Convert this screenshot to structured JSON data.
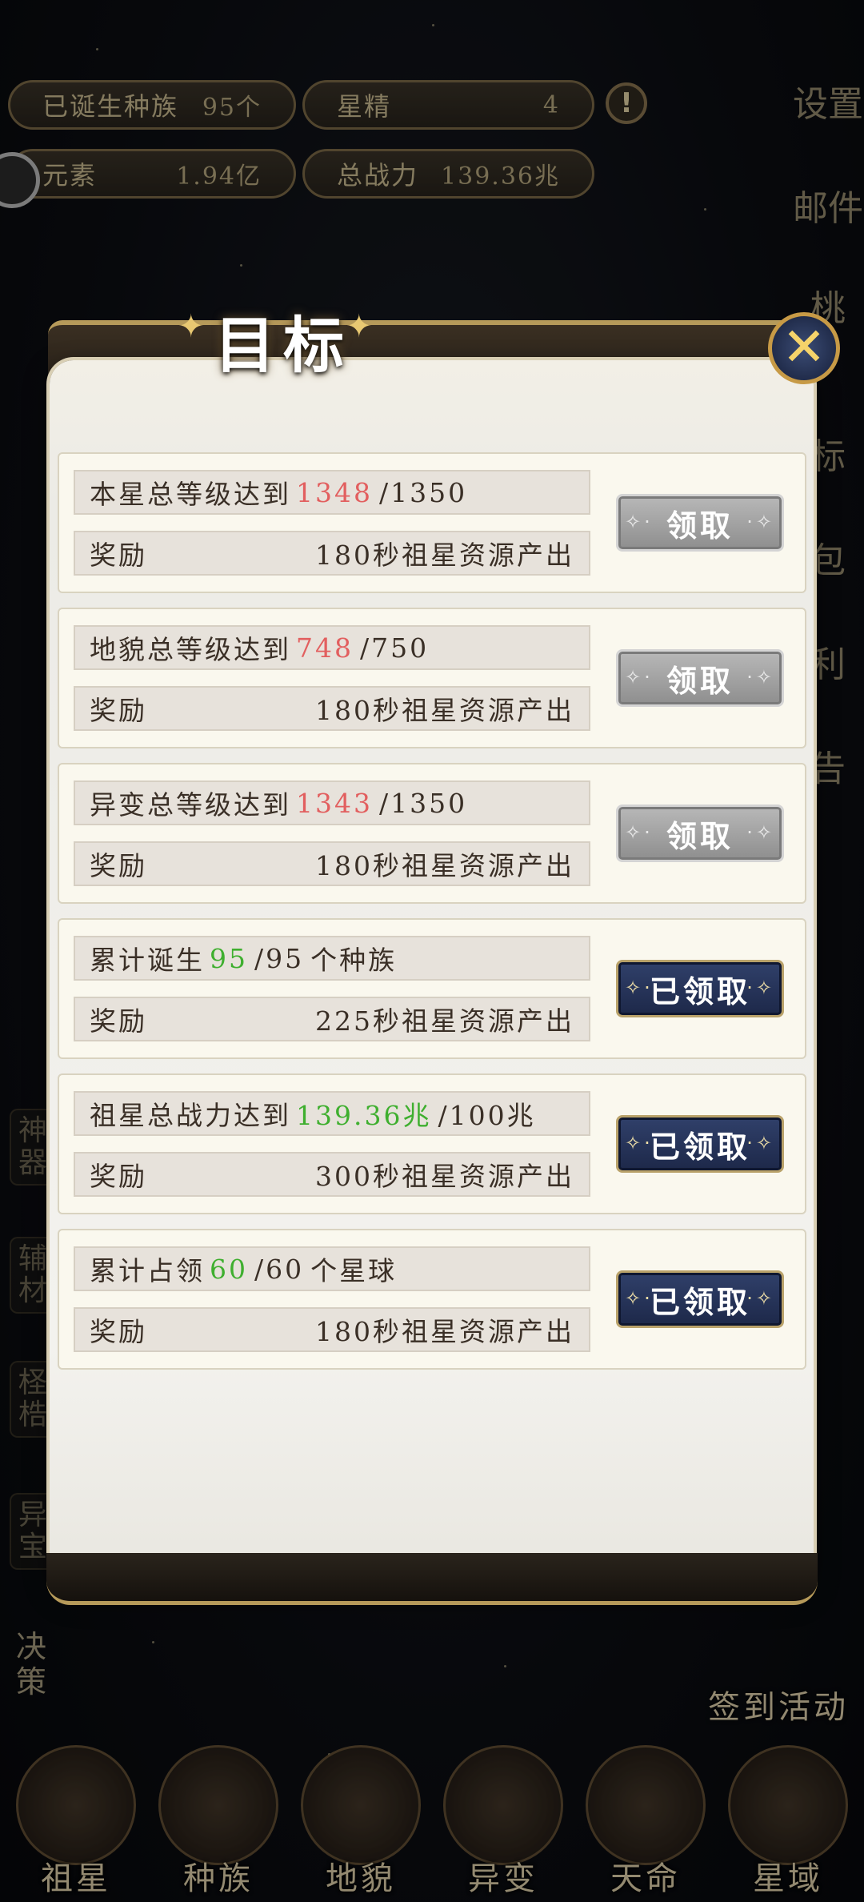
{
  "top_bar": {
    "races_label": "已诞生种族",
    "races_value": "95个",
    "star_essence_label": "星精",
    "star_essence_value": "4",
    "elements_label": "元素",
    "elements_value": "1.94亿",
    "power_label": "总战力",
    "power_value": "139.36兆"
  },
  "side_right": {
    "settings": "设置",
    "mail": "邮件",
    "partial_1": "桃",
    "partial_2": "标",
    "partial_3": "包",
    "partial_4": "利",
    "partial_5": "告"
  },
  "side_left": [
    "神器",
    "辅材",
    "柽梏",
    "异宝"
  ],
  "dialog": {
    "title": "目标",
    "tasks": [
      {
        "text": "本星总等级达到",
        "current": "1348",
        "target": "/1350",
        "suffix": "",
        "reward_label": "奖励",
        "reward": "180秒祖星资源产出",
        "button": "领取",
        "state": "grey",
        "progress_color": "red"
      },
      {
        "text": "地貌总等级达到",
        "current": "748",
        "target": "/750",
        "suffix": "",
        "reward_label": "奖励",
        "reward": "180秒祖星资源产出",
        "button": "领取",
        "state": "grey",
        "progress_color": "red"
      },
      {
        "text": "异变总等级达到",
        "current": "1343",
        "target": "/1350",
        "suffix": "",
        "reward_label": "奖励",
        "reward": "180秒祖星资源产出",
        "button": "领取",
        "state": "grey",
        "progress_color": "red"
      },
      {
        "text": "累计诞生",
        "current": "95",
        "target": "/95",
        "suffix": "个种族",
        "reward_label": "奖励",
        "reward": "225秒祖星资源产出",
        "button": "已领取",
        "state": "done",
        "progress_color": "green"
      },
      {
        "text": "祖星总战力达到",
        "current": "139.36兆",
        "target": "/100兆",
        "suffix": "",
        "reward_label": "奖励",
        "reward": "300秒祖星资源产出",
        "button": "已领取",
        "state": "done",
        "progress_color": "green"
      },
      {
        "text": "累计占领",
        "current": "60",
        "target": "/60",
        "suffix": "个星球",
        "reward_label": "奖励",
        "reward": "180秒祖星资源产出",
        "button": "已领取",
        "state": "done",
        "progress_color": "green"
      }
    ]
  },
  "decide_label": "决策",
  "sign_in_label": "签到活动",
  "bottom_nav": [
    "祖星",
    "种族",
    "地貌",
    "异变",
    "天命",
    "星域"
  ],
  "colors": {
    "progress_red": "#e25f5f",
    "progress_green": "#3faf2f",
    "claimed_button": "#25335a",
    "grey_button": "#a3a3a3"
  }
}
